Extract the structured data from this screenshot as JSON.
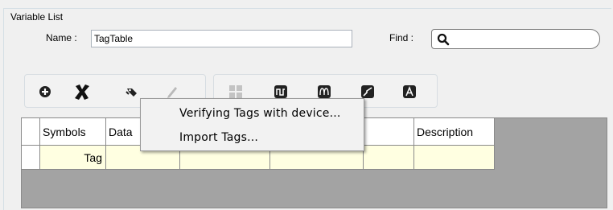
{
  "group": {
    "title": "Variable List"
  },
  "name_field": {
    "label": "Name :",
    "value": "TagTable"
  },
  "find_field": {
    "label": "Find :",
    "value": ""
  },
  "toolbar": {
    "left_icons": [
      "add-icon",
      "delete-icon",
      "tag-tool-icon",
      "edit-icon"
    ],
    "right_icons": [
      "grid-view-icon",
      "wave-square-icon",
      "wave-sine-icon",
      "step-icon",
      "letter-a-icon"
    ]
  },
  "table": {
    "headers": [
      "Symbols",
      "Data",
      "",
      "",
      "",
      "Description"
    ],
    "rows": [
      {
        "symbol": "Tag",
        "data": "",
        "c3": "",
        "c4": "",
        "c5": "",
        "description": ""
      }
    ],
    "header_bg": "#ffffff",
    "cell_bg": "#ffffe1",
    "empty_bg": "#a3a3a3"
  },
  "context_menu": {
    "items": [
      "Verifying Tags with device...",
      "Import Tags..."
    ]
  }
}
